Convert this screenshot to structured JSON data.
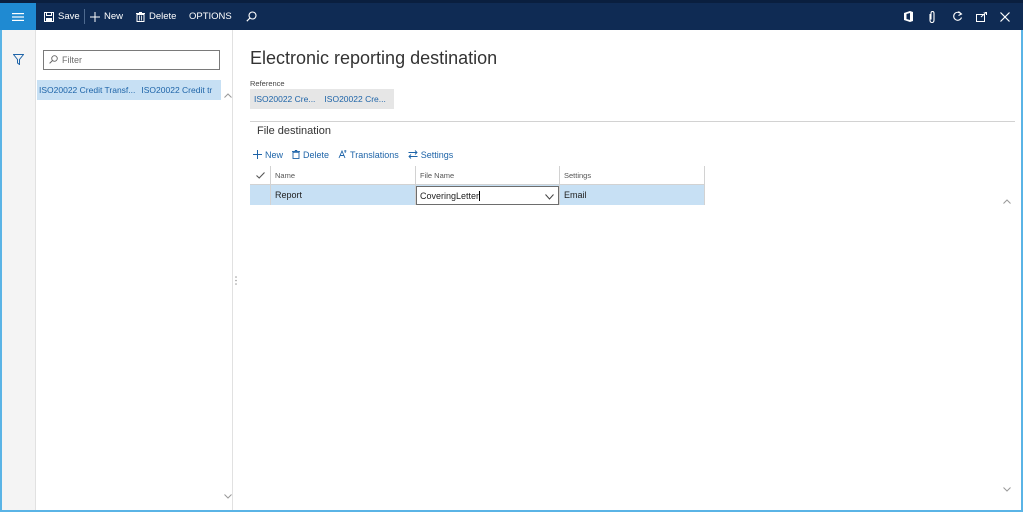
{
  "toolbar": {
    "save_label": "Save",
    "new_label": "New",
    "delete_label": "Delete",
    "options_label": "OPTIONS"
  },
  "icons": {
    "menu": "hamburger-icon",
    "save": "save-icon",
    "new": "plus-icon",
    "delete": "trash-icon",
    "search": "search-icon",
    "office": "office-icon",
    "attach": "paperclip-icon",
    "refresh": "refresh-icon",
    "popout": "popout-icon",
    "close": "close-icon",
    "filter": "funnel-icon"
  },
  "colors": {
    "topbar": "#0f2b54",
    "menu_accent": "#1f8ad2",
    "link": "#1e64a8",
    "selected_row": "#c7e0f4",
    "frame": "#5ab4e6"
  },
  "listpane": {
    "filter_placeholder": "Filter",
    "selected_item": {
      "col1": "ISO20022 Credit Transf...",
      "col2": "ISO20022 Credit tr"
    }
  },
  "main": {
    "title": "Electronic reporting destination",
    "reference_label": "Reference",
    "reference_values": [
      "ISO20022 Cre...",
      "ISO20022 Cre..."
    ],
    "section_title": "File destination",
    "actions": {
      "new": "New",
      "delete": "Delete",
      "translations": "Translations",
      "settings": "Settings"
    },
    "grid": {
      "headers": {
        "name": "Name",
        "file_name": "File Name",
        "settings": "Settings"
      },
      "rows": [
        {
          "name": "Report",
          "file_name": "CoveringLetter",
          "settings": "Email"
        }
      ]
    }
  }
}
